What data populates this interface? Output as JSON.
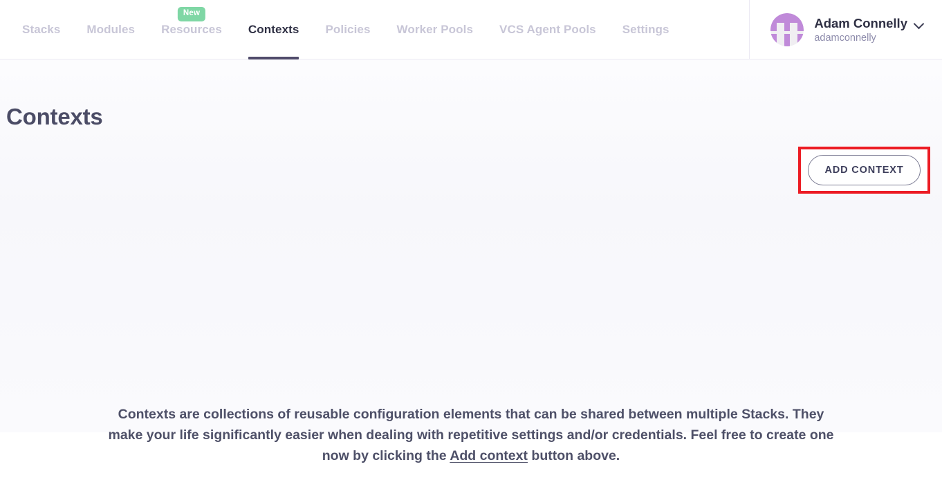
{
  "header": {
    "nav": [
      {
        "label": "Stacks",
        "active": false,
        "badge": null
      },
      {
        "label": "Modules",
        "active": false,
        "badge": null
      },
      {
        "label": "Resources",
        "active": false,
        "badge": "New"
      },
      {
        "label": "Contexts",
        "active": true,
        "badge": null
      },
      {
        "label": "Policies",
        "active": false,
        "badge": null
      },
      {
        "label": "Worker Pools",
        "active": false,
        "badge": null
      },
      {
        "label": "VCS Agent Pools",
        "active": false,
        "badge": null
      },
      {
        "label": "Settings",
        "active": false,
        "badge": null
      }
    ],
    "user": {
      "name": "Adam Connelly",
      "handle": "adamconnelly",
      "avatar_icon": "spacelift-logo-avatar",
      "chevron_icon": "chevron-down-icon"
    }
  },
  "main": {
    "title": "Contexts",
    "add_context_button": "ADD CONTEXT",
    "empty_state": {
      "text_before_link": "Contexts are collections of reusable configuration elements that can be shared between multiple Stacks. They make your life significantly easier when dealing with repetitive settings and/or credentials. Feel free to create one now by clicking the ",
      "link_text": "Add context",
      "text_after_link": " button above."
    }
  },
  "colors": {
    "accent_active": "#504c6b",
    "nav_inactive": "#c8c6d7",
    "badge_new": "#7fd7a5",
    "highlight_box": "#ec1c24",
    "avatar_purple": "#c08ad9",
    "text_primary": "#4e5068"
  }
}
